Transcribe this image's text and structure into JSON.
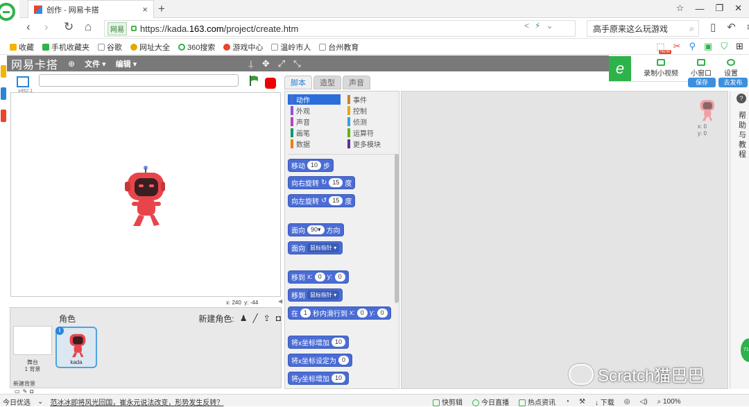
{
  "browser": {
    "tab_title": "创作 - 网易卡搭",
    "tab_close": "×",
    "new_tab": "+",
    "window_buttons": [
      "☆",
      "—",
      "❐",
      "✕"
    ],
    "nav": {
      "back": "‹",
      "forward": "›",
      "refresh": "↻",
      "home": "⌂"
    },
    "site_badge": "网易",
    "url_prefix": "https://kada.",
    "url_domain": "163.com",
    "url_path": "/project/create.htm",
    "search_text": "高手原来这么玩游戏",
    "bookmarks": [
      "收藏",
      "手机收藏夹",
      "谷歌",
      "网址大全",
      "360搜索",
      "游戏中心",
      "温岭市人",
      "台州教育"
    ]
  },
  "plugin": {
    "logo": "e",
    "record_label": "录制小视频",
    "mini_label": "小窗口",
    "settings_label": "设置",
    "new_badge": "NEW"
  },
  "kada": {
    "logo": "网易卡搭",
    "menu_file": "文件",
    "menu_edit": "编辑",
    "save_button": "保存",
    "publish_button": "去发布",
    "version": "v452.1",
    "coords_x_label": "x:",
    "coords_x": "240",
    "coords_y_label": "y:",
    "coords_y": "-44",
    "tabs": [
      "脚本",
      "造型",
      "声音"
    ],
    "categories": [
      {
        "label": "动作",
        "color": "#4a6cd4"
      },
      {
        "label": "事件",
        "color": "#c88330"
      },
      {
        "label": "外观",
        "color": "#8a55d7"
      },
      {
        "label": "控制",
        "color": "#e1a91a"
      },
      {
        "label": "声音",
        "color": "#bb42c3"
      },
      {
        "label": "侦测",
        "color": "#2ca5e2"
      },
      {
        "label": "画笔",
        "color": "#0e9a6c"
      },
      {
        "label": "运算符",
        "color": "#5cb712"
      },
      {
        "label": "数据",
        "color": "#ee7d16"
      },
      {
        "label": "更多模块",
        "color": "#632d99"
      }
    ],
    "blocks": {
      "move": "移动",
      "move_val": "10",
      "steps": "步",
      "turn_right": "向右旋转",
      "turn_right_val": "15",
      "degree": "度",
      "turn_left": "向左旋转",
      "turn_left_val": "15",
      "point_dir": "面向",
      "point_dir_val": "90▾",
      "direction": "方向",
      "point_towards": "面向",
      "mouse_pointer": "鼠标指针",
      "goto_xy": "移到",
      "x_label": "x:",
      "x_val": "0",
      "y_label": "y:",
      "y_val": "0",
      "goto": "移到",
      "glide_in": "在",
      "glide_secs": "1",
      "glide_text": "秒内滑行到",
      "change_x": "将x坐标增加",
      "change_x_val": "10",
      "set_x": "将x坐标设定为",
      "set_x_val": "0",
      "change_y": "将y坐标增加",
      "change_y_val": "10"
    },
    "sprites_header": "角色",
    "new_sprite": "新建角色:",
    "stage_label": "舞台",
    "stage_bg_count": "1 背景",
    "new_backdrop": "新建背景",
    "sprite_name": "kada",
    "sprite_info": "i",
    "sprite_x": "x: 0",
    "sprite_y": "y: 0",
    "help_icon": "?",
    "help_text": "帮助与教程"
  },
  "watermark": "Scratch猫巴巴",
  "fab_label": "71",
  "status": {
    "left_label": "今日优选",
    "news": "范冰冰即将风光回国，崔永元说法改变，形势发生反转？",
    "right_items": [
      "快剪辑",
      "今日直播",
      "热点资讯",
      "下载",
      "100%"
    ]
  },
  "colors": {
    "kada_bar": "#797979",
    "motion_block": "#4a6cd4",
    "browser_green": "#2db34a",
    "robot_red": "#e8454a"
  }
}
